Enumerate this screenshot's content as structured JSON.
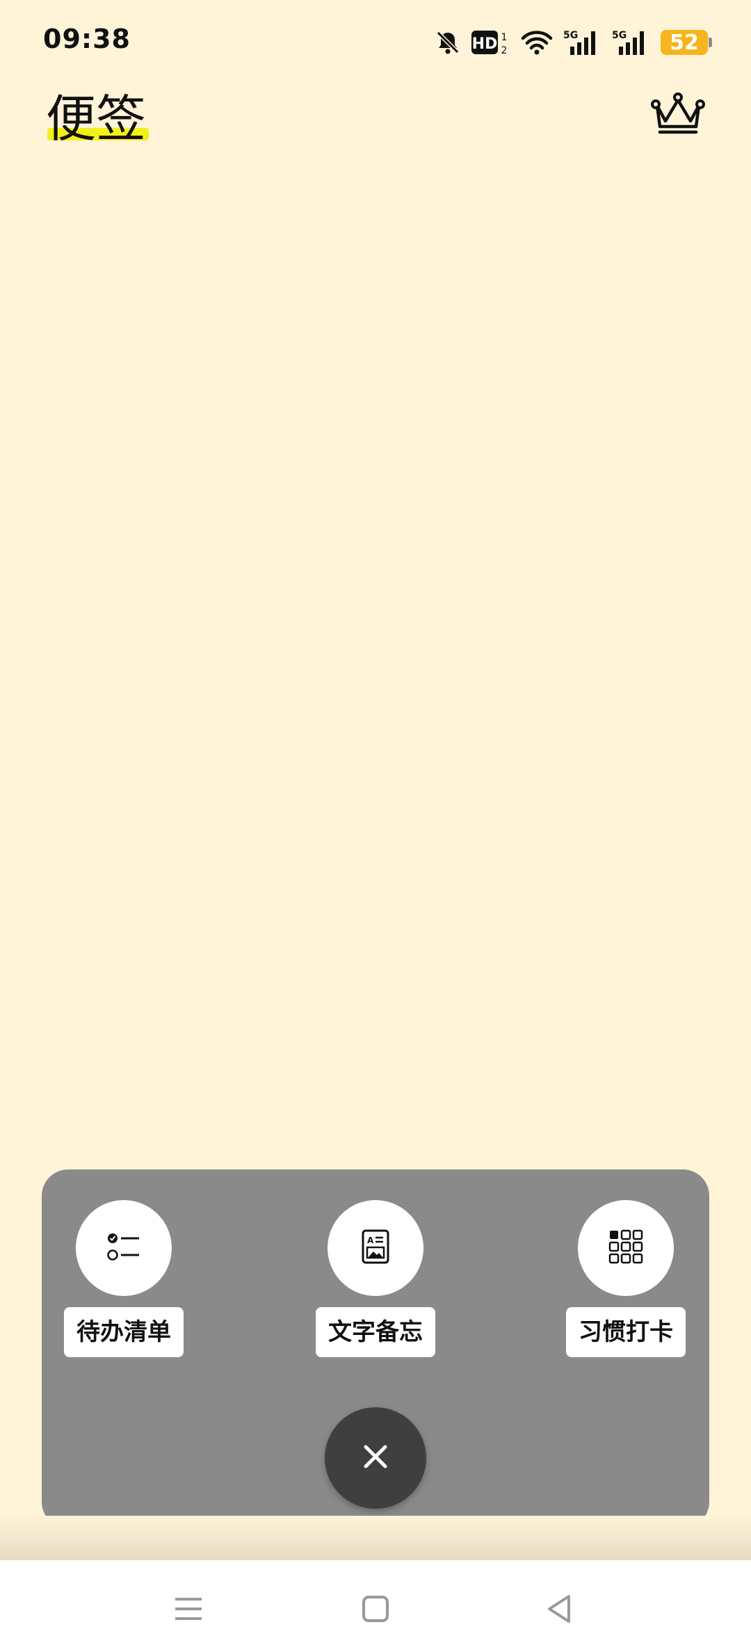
{
  "status_bar": {
    "time": "09:38",
    "icons": [
      "bell-muted-icon",
      "hd-icon",
      "wifi-icon",
      "signal-5g-icon",
      "signal-5g-icon"
    ],
    "battery_level": "52",
    "battery_color": "#f6b51e"
  },
  "header": {
    "title": "便签",
    "title_highlight_color": "#f4f01b",
    "premium_icon": "crown-icon"
  },
  "popup": {
    "actions": [
      {
        "label": "待办清单",
        "icon": "checklist-icon"
      },
      {
        "label": "文字备忘",
        "icon": "text-note-icon"
      },
      {
        "label": "习惯打卡",
        "icon": "habit-grid-icon"
      }
    ],
    "close_icon": "close-icon",
    "panel_color": "#8a8a8a"
  },
  "nav_bar": {
    "buttons": [
      "menu-icon",
      "home-icon",
      "back-icon"
    ]
  },
  "colors": {
    "background": "#fff3d8"
  }
}
